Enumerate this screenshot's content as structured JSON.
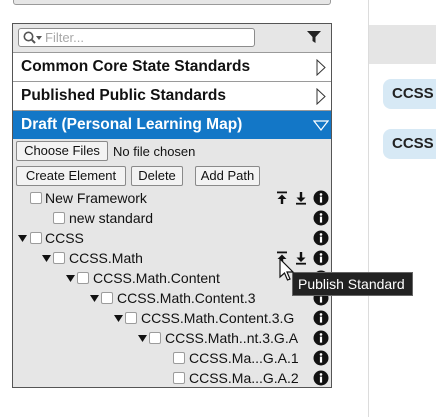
{
  "filter": {
    "placeholder": "Filter..."
  },
  "sections": [
    {
      "label": "Common Core State Standards"
    },
    {
      "label": "Published Public Standards"
    },
    {
      "label": "Draft (Personal Learning Map)"
    }
  ],
  "file": {
    "choose_label": "Choose Files",
    "status": "No file chosen"
  },
  "toolbar": {
    "create": "Create Element",
    "delete": "Delete",
    "add_path": "Add Path"
  },
  "tree": [
    {
      "label": "New Framework"
    },
    {
      "label": "new standard"
    },
    {
      "label": "CCSS"
    },
    {
      "label": "CCSS.Math"
    },
    {
      "label": "CCSS.Math.Content"
    },
    {
      "label": "CCSS.Math.Content.3"
    },
    {
      "label": "CCSS.Math.Content.3.G"
    },
    {
      "label": "CCSS.Math..nt.3.G.A"
    },
    {
      "label": "CCSS.Ma...G.A.1"
    },
    {
      "label": "CCSS.Ma...G.A.2"
    }
  ],
  "right": {
    "chips": [
      "CCSS",
      "CCSS"
    ]
  },
  "tooltip": {
    "text": "Publish Standard"
  },
  "colors": {
    "accent": "#1377c7",
    "chip": "#d7e9f5",
    "panel": "#e6e6e6"
  }
}
